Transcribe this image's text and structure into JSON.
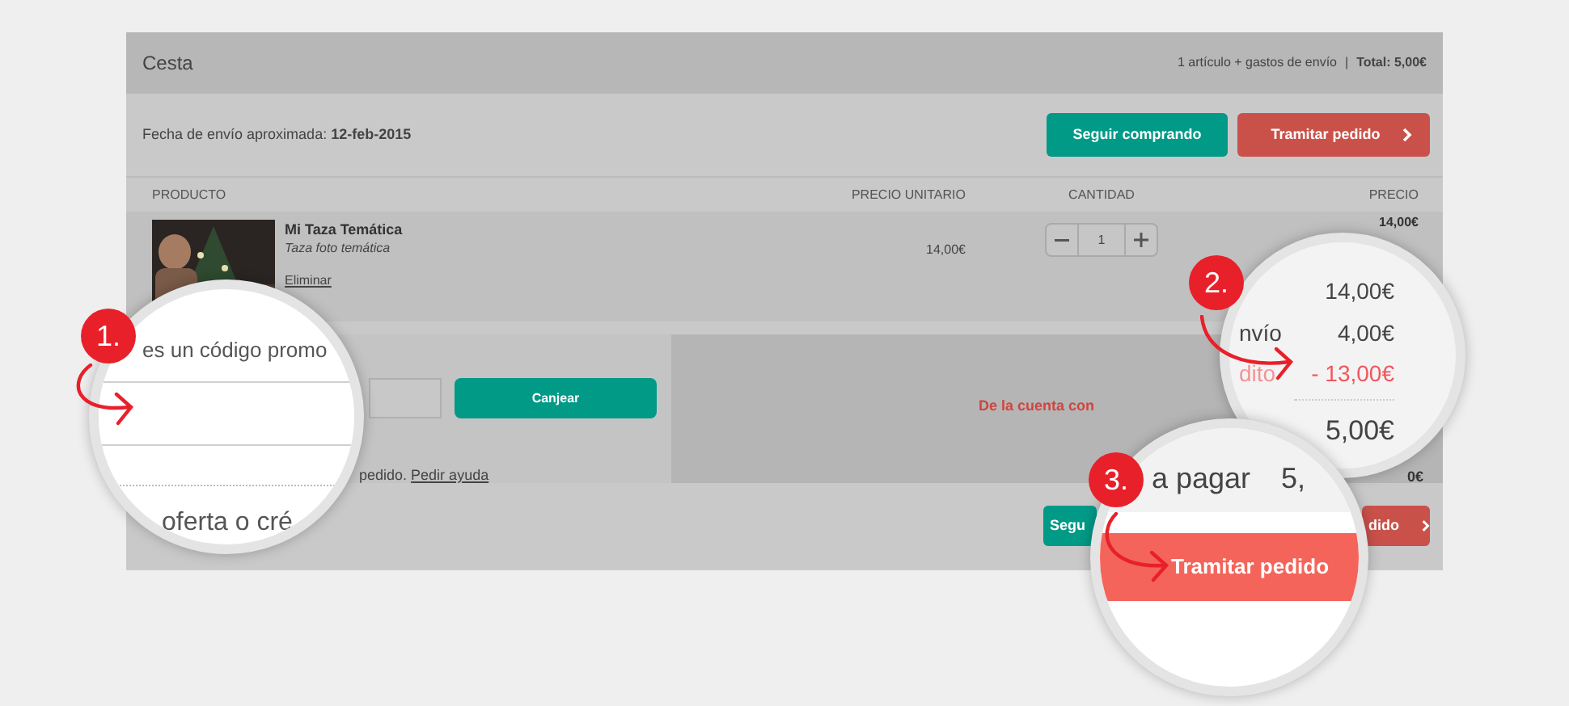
{
  "cart": {
    "title": "Cesta",
    "summary": "1 artículo + gastos de envío",
    "separator": "|",
    "total": "Total: 5,00€"
  },
  "shipping": "Fecha de envío aproximada: **12-feb-2015**",
  "top_buttons": [
    {
      "label": "Seguir comprando",
      "kind": "secondary"
    },
    {
      "label": "Tramitar pedido",
      "kind": "primary"
    }
  ],
  "columns": [
    "PRODUCTO",
    "PRECIO UNITARIO",
    "CANTIDAD",
    "PRECIO"
  ],
  "item": {
    "name": "Mi Taza Temática",
    "description": "Taza foto temática",
    "remove": "Eliminar",
    "unit_price": "14,00€",
    "quantity": "1",
    "price": "14,00€"
  },
  "promo": {
    "button": "Canjear",
    "help": "pedido.",
    "help_link": "Pedir ayuda"
  },
  "credit_note": "De la cuenta con",
  "total_fragment": "0€",
  "bottom_buttons": [
    {
      "label": "Segu",
      "kind": "secondary"
    },
    {
      "label": "dido",
      "kind": "primary"
    }
  ],
  "magnifiers": [
    {
      "kind": "promo",
      "badge": "1.",
      "heading": "es un código promo",
      "footer": "oferta o cré"
    },
    {
      "kind": "summary",
      "badge": "2.",
      "rows": [
        {
          "value": "14,00€",
          "discount": false
        },
        {
          "label": "nvío",
          "value": "4,00€",
          "discount": false
        },
        {
          "label": "dito",
          "value": "- 13,00€",
          "discount": true
        },
        {
          "value": "5,00€",
          "discount": false
        }
      ]
    },
    {
      "kind": "checkout",
      "badge": "3.",
      "label": "a pagar",
      "value": "5,",
      "button": "Tramitar pedido"
    }
  ]
}
